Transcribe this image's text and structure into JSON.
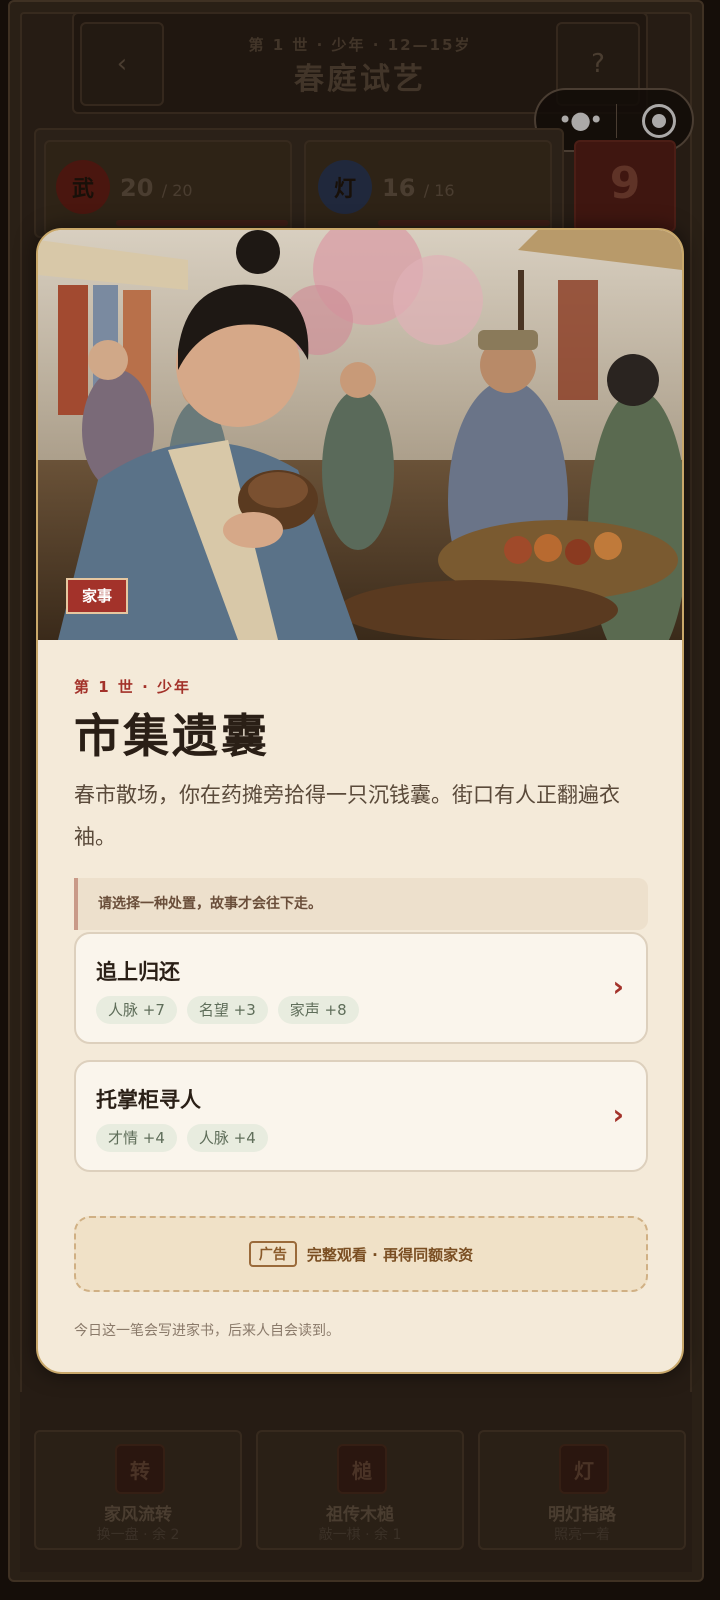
{
  "header": {
    "subtitle": "第 1 世 · 少年 · 12—15岁",
    "title": "春庭试艺",
    "back_icon": "‹",
    "help_icon": "?"
  },
  "stats": [
    {
      "badge": "武",
      "value": "20",
      "max": "/ 20",
      "color": "#7a2418"
    },
    {
      "badge": "灯",
      "value": "16",
      "max": "/ 16",
      "color": "#2e4a78"
    }
  ],
  "counter": "9",
  "modal": {
    "category_tag": "家事",
    "era": "第 1 世 · 少年",
    "title": "市集遗囊",
    "description": "春市散场，你在药摊旁拾得一只沉钱囊。街口有人正翻遍衣袖。",
    "hint": "请选择一种处置，故事才会往下走。",
    "choices": [
      {
        "title": "追上归还",
        "effects": [
          "人脉 +7",
          "名望 +3",
          "家声 +8"
        ]
      },
      {
        "title": "托掌柜寻人",
        "effects": [
          "才情 +4",
          "人脉 +4"
        ]
      }
    ],
    "ad": {
      "label": "广告",
      "text": "完整观看 · 再得同额家资"
    },
    "footer": "今日这一笔会写进家书，后来人自会读到。"
  },
  "tools": [
    {
      "icon": "转",
      "name": "家风流转",
      "sub": "换一盘 · 余 2"
    },
    {
      "icon": "槌",
      "name": "祖传木槌",
      "sub": "敲一棋 · 余 1"
    },
    {
      "icon": "灯",
      "name": "明灯指路",
      "sub": "照亮一着"
    }
  ],
  "colors": {
    "accent": "#a3322a",
    "card_bg": "#f4ead9",
    "border_gold": "#c9a86a"
  }
}
